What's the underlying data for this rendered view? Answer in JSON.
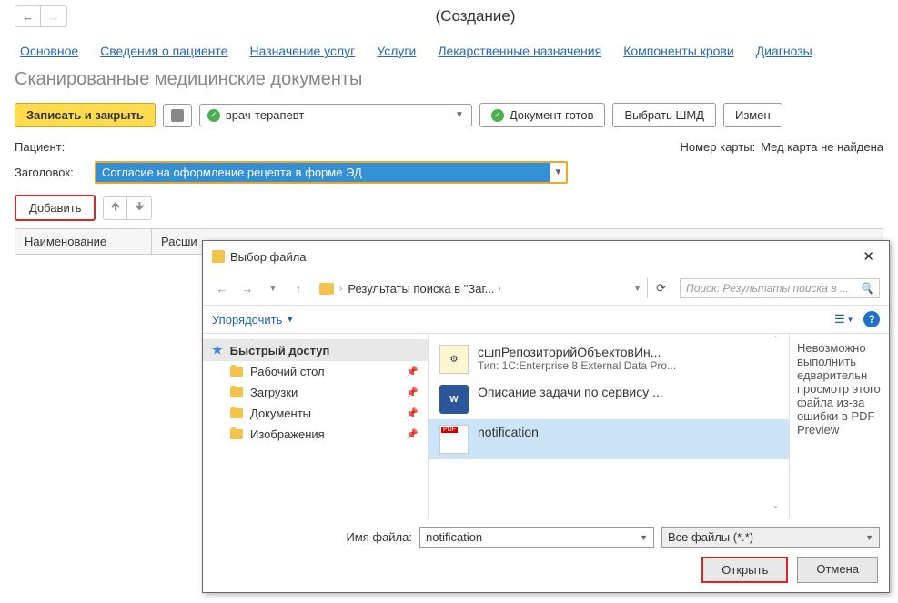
{
  "header": {
    "title": "(Создание)"
  },
  "tabs": [
    "Основное",
    "Сведения о пациенте",
    "Назначение услуг",
    "Услуги",
    "Лекарственные назначения",
    "Компоненты крови",
    "Диагнозы"
  ],
  "subtitle": "Сканированные медицинские документы",
  "toolbar": {
    "save_close": "Записать и закрыть",
    "role_value": "врач-терапевт",
    "doc_ready": "Документ готов",
    "choose_shmd": "Выбрать ШМД",
    "change": "Измен"
  },
  "form": {
    "patient_label": "Пациент:",
    "card_label": "Номер карты:",
    "card_value": "Мед карта не найдена",
    "title_label": "Заголовок:",
    "title_value": "Согласие на оформление рецепта в форме ЭД"
  },
  "list": {
    "add": "Добавить",
    "col_name": "Наименование",
    "col_ext": "Расши"
  },
  "dialog": {
    "title": "Выбор файла",
    "path_label": "Результаты поиска в \"Заг...",
    "search_placeholder": "Поиск: Результаты поиска в ...",
    "organize": "Упорядочить",
    "nav": {
      "quick": "Быстрый доступ",
      "desktop": "Рабочий стол",
      "downloads": "Загрузки",
      "documents": "Документы",
      "pictures": "Изображения"
    },
    "files": [
      {
        "name": "сшпРепозиторийОбъектовИн...",
        "meta": "Тип: 1C:Enterprise 8 External Data Pro..."
      },
      {
        "name": "Описание задачи по сервису ...",
        "meta": ""
      },
      {
        "name": "notification",
        "meta": ""
      }
    ],
    "preview_error": "Невозможно выполнить едварительн просмотр этого файла из-за ошибки в PDF Preview",
    "filename_label": "Имя файла:",
    "filename_value": "notification",
    "filter_value": "Все файлы (*.*)",
    "open": "Открыть",
    "cancel": "Отмена"
  }
}
